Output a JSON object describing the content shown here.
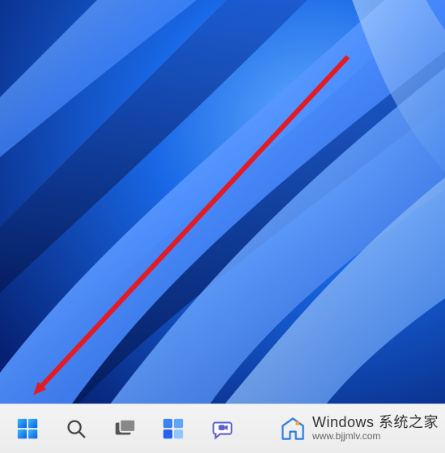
{
  "taskbar": {
    "items": [
      {
        "name": "start-button",
        "icon": "windows-logo-icon"
      },
      {
        "name": "search-button",
        "icon": "search-icon"
      },
      {
        "name": "task-view-button",
        "icon": "task-view-icon"
      },
      {
        "name": "widgets-button",
        "icon": "widgets-icon"
      },
      {
        "name": "teams-chat-button",
        "icon": "chat-icon"
      }
    ]
  },
  "annotation": {
    "arrow_points_to": "start-button",
    "arrow_color": "#e31b23"
  },
  "watermark": {
    "title": "Windows 系统之家",
    "url": "www.bjjmlv.com"
  },
  "colors": {
    "taskbar_bg": "#f0f0f0",
    "wallpaper_primary": "#0a5ee8",
    "wallpaper_dark": "#062a8f",
    "wallpaper_light": "#5aa6ff",
    "arrow": "#e31b23"
  }
}
